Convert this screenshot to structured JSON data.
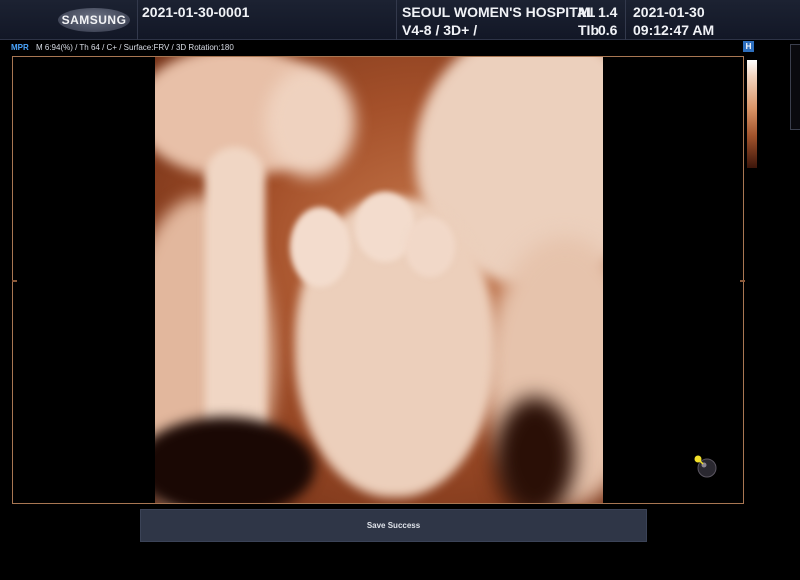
{
  "header": {
    "brand": "SAMSUNG",
    "patient_id": "2021-01-30-0001",
    "hospital": "SEOUL WOMEN'S HOSPITAL",
    "probe_preset": "V4-8 / 3D+ /",
    "mi_label": "MI",
    "mi_value": "1.4",
    "tib_label": "TIb",
    "tib_value": "0.6",
    "date": "2021-01-30",
    "time": "09:12:47 AM"
  },
  "params": {
    "mode": "MPR",
    "text": "M 6:94(%) / Th 64 / C+ / Surface:FRV / 3D Rotation:180"
  },
  "viewport": {
    "orientation_badge": "H",
    "accent_color": "#a87652"
  },
  "status": {
    "message": "Save Success"
  }
}
